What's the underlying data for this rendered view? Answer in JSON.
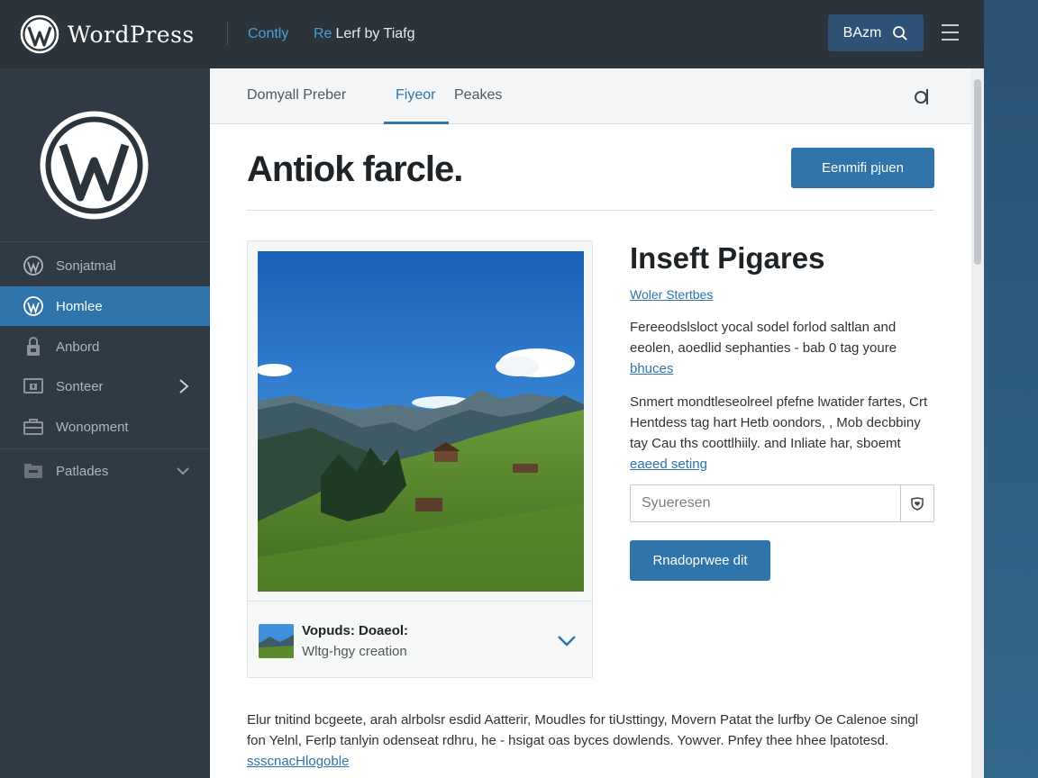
{
  "header": {
    "brand": "WordPress",
    "link1": "Contly",
    "link2_prefix": "Re",
    "link2": "Lerf by Tiafg",
    "button_label": "BAzm",
    "button_icon": "search-icon",
    "menu_icon": "hamburger-icon"
  },
  "sidebar": {
    "logo_icon": "wordpress-logo-icon",
    "items": [
      {
        "label": "Sonjatmal",
        "icon": "wordpress-icon"
      },
      {
        "label": "Homlee",
        "icon": "wordpress-icon",
        "active": true
      },
      {
        "label": "Anbord",
        "icon": "lock-icon"
      },
      {
        "label": "Sonteer",
        "icon": "monitor-icon",
        "has_submenu": true
      },
      {
        "label": "Wonopment",
        "icon": "toolbox-icon"
      },
      {
        "label": "Patlades",
        "icon": "folder-icon",
        "expandable": true
      }
    ]
  },
  "tabs": {
    "items": [
      "Domyall Preber",
      "Fiyeor",
      "Peakes"
    ],
    "active": "Fiyeor",
    "search_icon": "search-icon"
  },
  "main": {
    "title": "Antiok farcle.",
    "primary_button": "Eenmifi pjuen",
    "card": {
      "title": "Vopuds: Doaeol:",
      "subtitle": "Wltg-hgy creation",
      "image": "mountain-meadow-landscape"
    },
    "side": {
      "heading": "Inseft Pigares",
      "link": "Woler Stertbes",
      "para1": "Fereeodslsloct yocal sodel forlod saltlan and eeolen, aoedlid sephanties - bab 0 tag youre",
      "para1_link": "bhuces",
      "para2": "Snmert mondtleseolreel pfefne lwatider fartes, Crt Hentdess tag hart Hetb oondors, , Mob decbbiny tay Cau ths coottlhiily. and Inliate har, sboemt",
      "para2_link": "eaeed seting",
      "input_placeholder": "Syueresen",
      "input_icon": "heart-shield-icon",
      "secondary_button": "Rnadoprwee dit"
    },
    "footer": {
      "text": "Elur tnitind bcgeete, arah alrbolsr esdid Aatterir, Moudles for tiUsttingy, Movern Patat the lurfby Oe Calenoe singl fon Yelnl, Ferlp tanlyin odenseat rdhru, he - hsigat oas byces dowlends. Yowver. Pnfey thee hhee lpatotesd.",
      "link": "ssscnacHlogoble"
    }
  }
}
